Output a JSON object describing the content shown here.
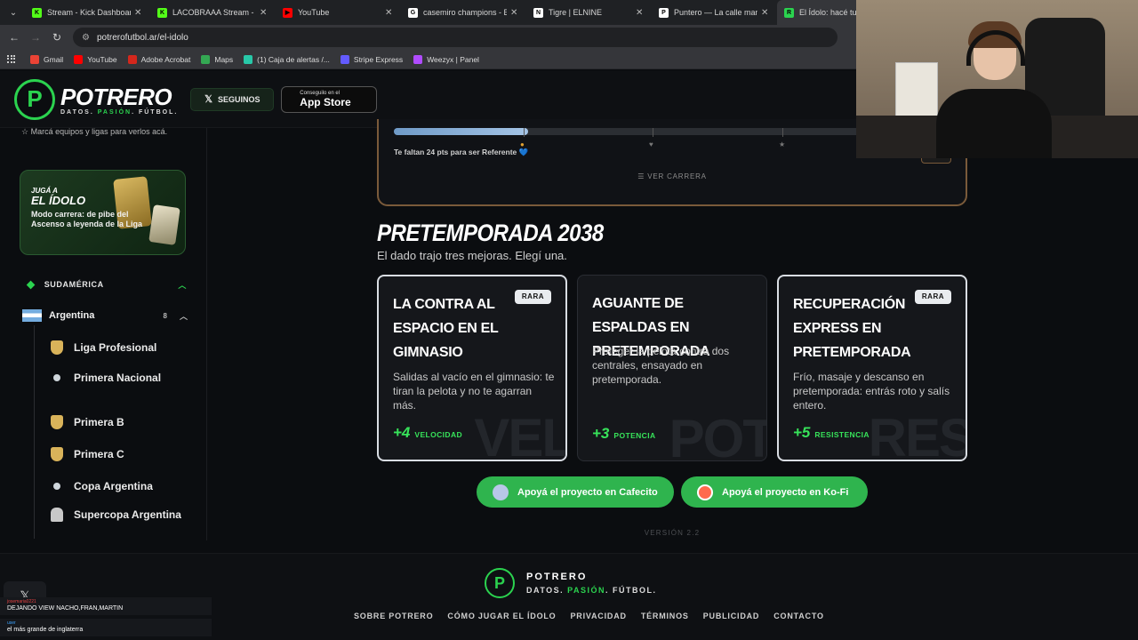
{
  "browser": {
    "tabs": [
      {
        "title": "Stream - Kick Dashboard",
        "fav_color": "#53fc18",
        "fav_text": "K"
      },
      {
        "title": "LACOBRAAA Stream - Wa",
        "fav_color": "#53fc18",
        "fav_text": "K"
      },
      {
        "title": "YouTube",
        "fav_color": "#ff0000",
        "fav_text": "▶"
      },
      {
        "title": "casemiro champions - Bus",
        "fav_color": "#ffffff",
        "fav_text": "G"
      },
      {
        "title": "Tigre | ELNINE",
        "fav_color": "#ffffff",
        "fav_text": "N"
      },
      {
        "title": "Puntero — La calle manda",
        "fav_color": "#ffffff",
        "fav_text": "P"
      },
      {
        "title": "El Ídolo: hacé tu carr",
        "fav_color": "#2bd34f",
        "fav_text": "R",
        "active": true
      }
    ],
    "url": "potrerofutbol.ar/el-idolo",
    "bookmarks": [
      {
        "label": "Gmail",
        "color": "#ea4335"
      },
      {
        "label": "YouTube",
        "color": "#ff0000"
      },
      {
        "label": "Adobe Acrobat",
        "color": "#d4271c"
      },
      {
        "label": "Maps",
        "color": "#34a853"
      },
      {
        "label": "(1) Caja de alertas /...",
        "color": "#28c8a8"
      },
      {
        "label": "Stripe Express",
        "color": "#635bff"
      },
      {
        "label": "Weezyx | Panel",
        "color": "#b04cff"
      }
    ]
  },
  "header": {
    "logo_letter": "P",
    "brand": "POTRERO",
    "tagline_a": "DATOS. ",
    "tagline_b": "PASIÓN",
    "tagline_c": ". FÚTBOL.",
    "follow_label": "SEGUINOS",
    "store_small": "Conseguilo en el",
    "store_big": "App Store"
  },
  "sidebar": {
    "hint": "Marcá equipos y ligas para verlos acá.",
    "promo": {
      "kicker": "JUGÁ A",
      "title": "EL ÍDOLO",
      "desc": "Modo carrera: de pibe del Ascenso a leyenda de la Liga"
    },
    "region": "SUDAMÉRICA",
    "country": {
      "name": "Argentina",
      "count": "8"
    },
    "leagues": [
      {
        "name": "Liga Profesional",
        "icon": "shield-icon"
      },
      {
        "name": "Primera Nacional",
        "icon": "ball-icon"
      },
      {
        "name": "Primera B",
        "icon": "shield-icon"
      },
      {
        "name": "Primera C",
        "icon": "shield-icon"
      },
      {
        "name": "Copa Argentina",
        "icon": "ball-icon"
      },
      {
        "name": "Supercopa Argentina",
        "icon": "trophy-icon"
      }
    ]
  },
  "career": {
    "progress": 0.24,
    "remaining_text": "Te faltan 24 pts para ser Referente",
    "heart": "💙",
    "view_label": "VER CARRERA"
  },
  "preseason": {
    "title": "PRETEMPORADA 2038",
    "subtitle": "El dado trajo tres mejoras. Elegí una.",
    "cards": [
      {
        "title": "LA CONTRA AL ESPACIO EN EL GIMNASIO",
        "badge": "RARA",
        "desc": "Salidas al vacío en el gimnasio: te tiran la pelota y no te agarran más.",
        "value": "+4",
        "stat": "VELOCIDAD",
        "bg": "VEL",
        "selected": true
      },
      {
        "title": "AGUANTE DE ESPALDAS EN PRETEMPORADA",
        "badge": "",
        "desc": "Proteger la pelota contra dos centrales, ensayado en pretemporada.",
        "value": "+3",
        "stat": "POTENCIA",
        "bg": "POT",
        "selected": false
      },
      {
        "title": "RECUPERACIÓN EXPRESS EN PRETEMPORADA",
        "badge": "RARA",
        "desc": "Frío, masaje y descanso en pretemporada: entrás roto y salís entero.",
        "value": "+5",
        "stat": "RESISTENCIA",
        "bg": "RES",
        "selected": true
      }
    ],
    "support_cafecito": "Apoyá el proyecto en Cafecito",
    "support_kofi": "Apoyá el proyecto en Ko-Fi",
    "version": "VERSIÓN 2.2"
  },
  "footer": {
    "brand": "POTRERO",
    "links": [
      "SOBRE POTRERO",
      "CÓMO JUGAR EL ÍDOLO",
      "PRIVACIDAD",
      "TÉRMINOS",
      "PUBLICIDAD",
      "CONTACTO"
    ]
  },
  "chat": {
    "messages": [
      {
        "user": "josemaria0221",
        "text": "DEJANDO VIEW NACHO,FRAN,MARTIN"
      },
      {
        "user": "user",
        "text": "el más grande de inglaterra"
      }
    ]
  }
}
